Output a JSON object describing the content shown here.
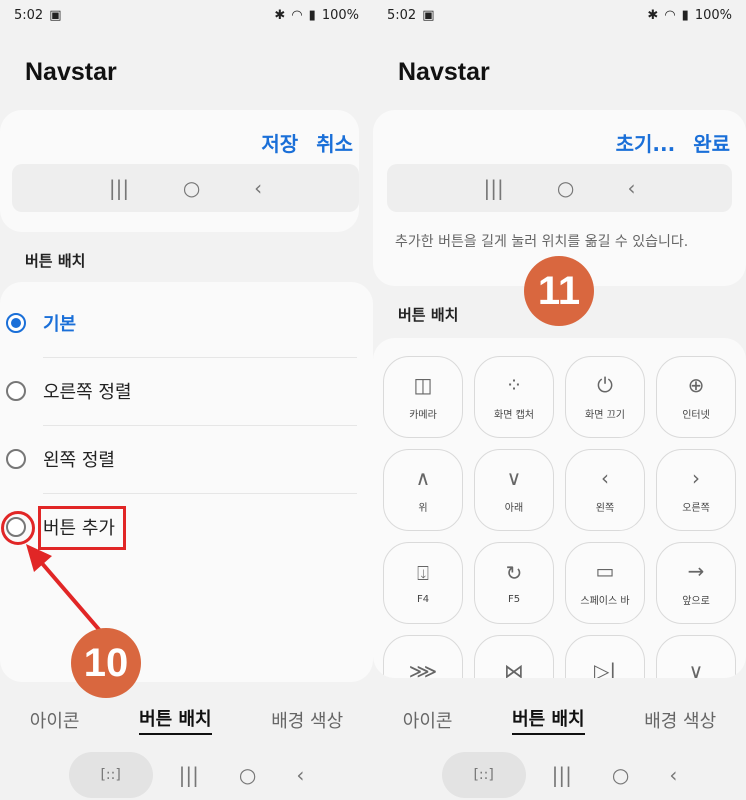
{
  "left": {
    "status": {
      "time": "5:02",
      "battery": "100%"
    },
    "title": "Navstar",
    "actions": {
      "save": "저장",
      "cancel": "취소"
    },
    "preview": {
      "recent": "|||",
      "home": "○",
      "back": "‹"
    },
    "section_label": "버튼 배치",
    "options": [
      {
        "label": "기본",
        "selected": true
      },
      {
        "label": "오른쪽 정렬",
        "selected": false
      },
      {
        "label": "왼쪽 정렬",
        "selected": false
      },
      {
        "label": "버튼 추가",
        "selected": false
      }
    ],
    "badge": "10",
    "tabs": [
      "아이콘",
      "버튼 배치",
      "배경 색상"
    ],
    "active_tab": "버튼 배치",
    "sysnav": {
      "capture": "[::]",
      "recent": "|||",
      "home": "○",
      "back": "‹"
    }
  },
  "right": {
    "status": {
      "time": "5:02",
      "battery": "100%"
    },
    "title": "Navstar",
    "actions": {
      "reset": "초기...",
      "done": "완료"
    },
    "preview": {
      "recent": "|||",
      "home": "○",
      "back": "‹"
    },
    "info": "추가한 버튼을 길게 눌러 위치를 옮길 수 있습니다.",
    "section_label": "버튼 배치",
    "badge": "11",
    "buttons": [
      {
        "icon": "◫",
        "label": "카메라"
      },
      {
        "icon": "⁘",
        "label": "화면 캡처"
      },
      {
        "icon": "⏻",
        "label": "화면 끄기"
      },
      {
        "icon": "⊕",
        "label": "인터넷"
      },
      {
        "icon": "∧",
        "label": "위"
      },
      {
        "icon": "∨",
        "label": "아래"
      },
      {
        "icon": "‹",
        "label": "왼쪽"
      },
      {
        "icon": "›",
        "label": "오른쪽"
      },
      {
        "icon": "⍗",
        "label": "F4"
      },
      {
        "icon": "↻",
        "label": "F5"
      },
      {
        "icon": "▭",
        "label": "스페이스 바"
      },
      {
        "icon": "→",
        "label": "앞으로"
      },
      {
        "icon": "⋙",
        "label": ""
      },
      {
        "icon": "⋈",
        "label": ""
      },
      {
        "icon": "▷|",
        "label": ""
      },
      {
        "icon": "∨",
        "label": ""
      }
    ],
    "tabs": [
      "아이콘",
      "버튼 배치",
      "배경 색상"
    ],
    "active_tab": "버튼 배치",
    "sysnav": {
      "capture": "[::]",
      "recent": "|||",
      "home": "○",
      "back": "‹"
    }
  },
  "colors": {
    "accent": "#1a6fd8",
    "annotation": "#e12626",
    "badge": "#d9673f"
  }
}
